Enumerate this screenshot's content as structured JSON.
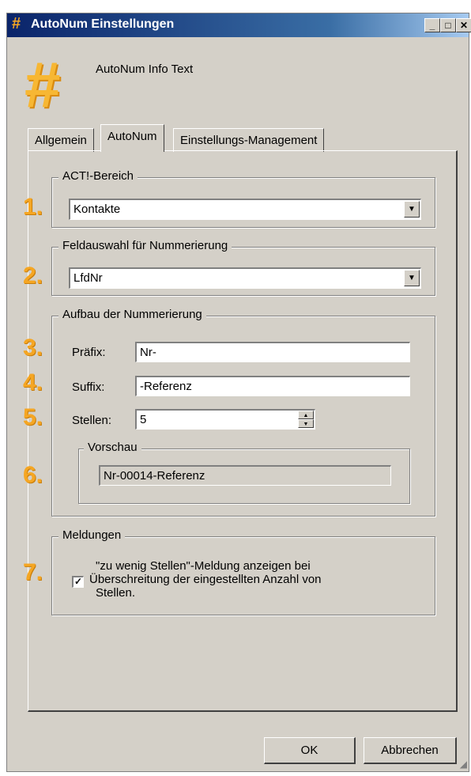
{
  "window": {
    "title": "AutoNum Einstellungen",
    "icon": "hash-icon",
    "minimize": "_",
    "maximize": "□",
    "close": "✕"
  },
  "header": {
    "info_text": "AutoNum Info Text"
  },
  "tabs": [
    {
      "label": "Allgemein",
      "active": false
    },
    {
      "label": "AutoNum",
      "active": true
    },
    {
      "label": "Einstellungs-Management",
      "active": false
    }
  ],
  "act_bereich": {
    "legend": "ACT!-Bereich",
    "number": "1.",
    "value": "Kontakte"
  },
  "feldauswahl": {
    "legend": "Feldauswahl für Nummerierung",
    "number": "2.",
    "value": "LfdNr"
  },
  "aufbau": {
    "legend": "Aufbau der Nummerierung",
    "prefix": {
      "number": "3.",
      "label": "Präfix:",
      "value": "Nr-"
    },
    "suffix": {
      "number": "4.",
      "label": "Suffix:",
      "value": "-Referenz"
    },
    "stellen": {
      "number": "5.",
      "label": "Stellen:",
      "value": "5"
    },
    "vorschau": {
      "legend": "Vorschau",
      "number": "6.",
      "value": "Nr-00014-Referenz"
    }
  },
  "meldungen": {
    "legend": "Meldungen",
    "number": "7.",
    "checked": true,
    "checkbox_line1": "\"zu wenig Stellen\"-Meldung anzeigen bei",
    "checkbox_line2": "Überschreitung der eingestellten Anzahl von",
    "checkbox_line3": "Stellen."
  },
  "buttons": {
    "ok": "OK",
    "cancel": "Abbrechen"
  },
  "colors": {
    "accent": "#f5a623",
    "titlebar": "#0a246a",
    "face": "#d4d0c8"
  }
}
